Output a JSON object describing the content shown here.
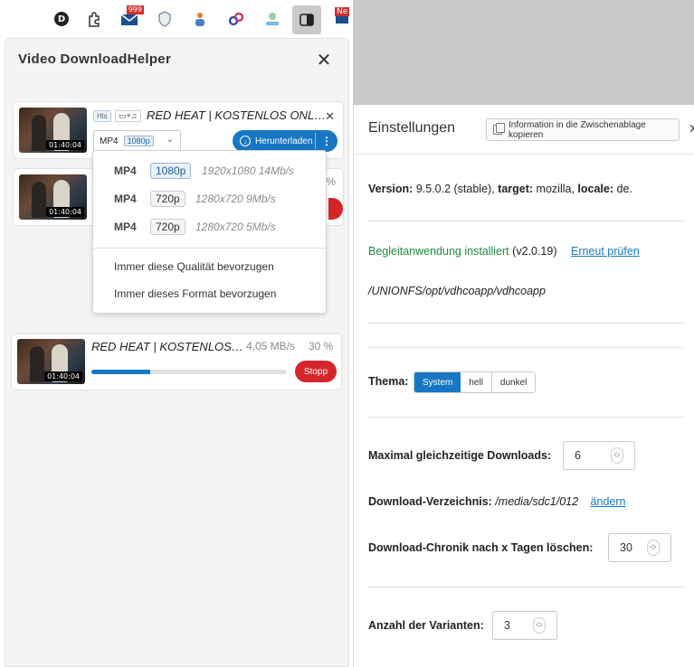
{
  "toolbar": {
    "profile_letter": "D",
    "mail_badge": "999",
    "new_badge": "Ne"
  },
  "panel": {
    "title": "Video DownloadHelper"
  },
  "items": [
    {
      "title": "RED HEAT | KOSTENLOS ONL…",
      "duration": "01:40:04",
      "stream_tag": "Hls",
      "av_tag": "▭+♫",
      "format": "MP4",
      "quality": "1080p",
      "download_label": "Herunterladen"
    },
    {
      "duration": "01:40:04",
      "percent": "%"
    },
    {
      "title": "RED HEAT | KOSTENLOS…",
      "duration": "01:40:04",
      "rate": "4,05 MB/s",
      "percent": "30 %",
      "progress": 0.3,
      "stop_label": "Stopp"
    }
  ],
  "dropdown": {
    "variants": [
      {
        "format": "MP4",
        "quality": "1080p",
        "info": "1920x1080 14Mb/s",
        "selected": true
      },
      {
        "format": "MP4",
        "quality": "720p",
        "info": "1280x720 9Mb/s",
        "selected": false
      },
      {
        "format": "MP4",
        "quality": "720p",
        "info": "1280x720 5Mb/s",
        "selected": false
      }
    ],
    "prefer_quality": "Immer diese Qualität bevorzugen",
    "prefer_format": "Immer dieses Format bevorzugen"
  },
  "settings": {
    "title": "Einstellungen",
    "copy_button": "Information in die Zwischenablage kopieren",
    "version_label": "Version:",
    "version_value": "9.5.0.2 (stable),",
    "target_label": "target:",
    "target_value": "mozilla,",
    "locale_label": "locale:",
    "locale_value": "de.",
    "companion_status": "Begleitanwendung installiert",
    "companion_version": "(v2.0.19)",
    "recheck_link": "Erneut prüfen",
    "companion_path": "/UNIONFS/opt/vdhcoapp/vdhcoapp",
    "theme_label": "Thema:",
    "theme_options": [
      "System",
      "hell",
      "dunkel"
    ],
    "max_downloads_label": "Maximal gleichzeitige Downloads:",
    "max_downloads_value": "6",
    "dir_label": "Download-Verzeichnis:",
    "dir_value": "/media/sdc1/012",
    "dir_change": "ändern",
    "history_label": "Download-Chronik nach x Tagen löschen:",
    "history_value": "30",
    "variants_label": "Anzahl der Varianten:",
    "variants_value": "3"
  }
}
